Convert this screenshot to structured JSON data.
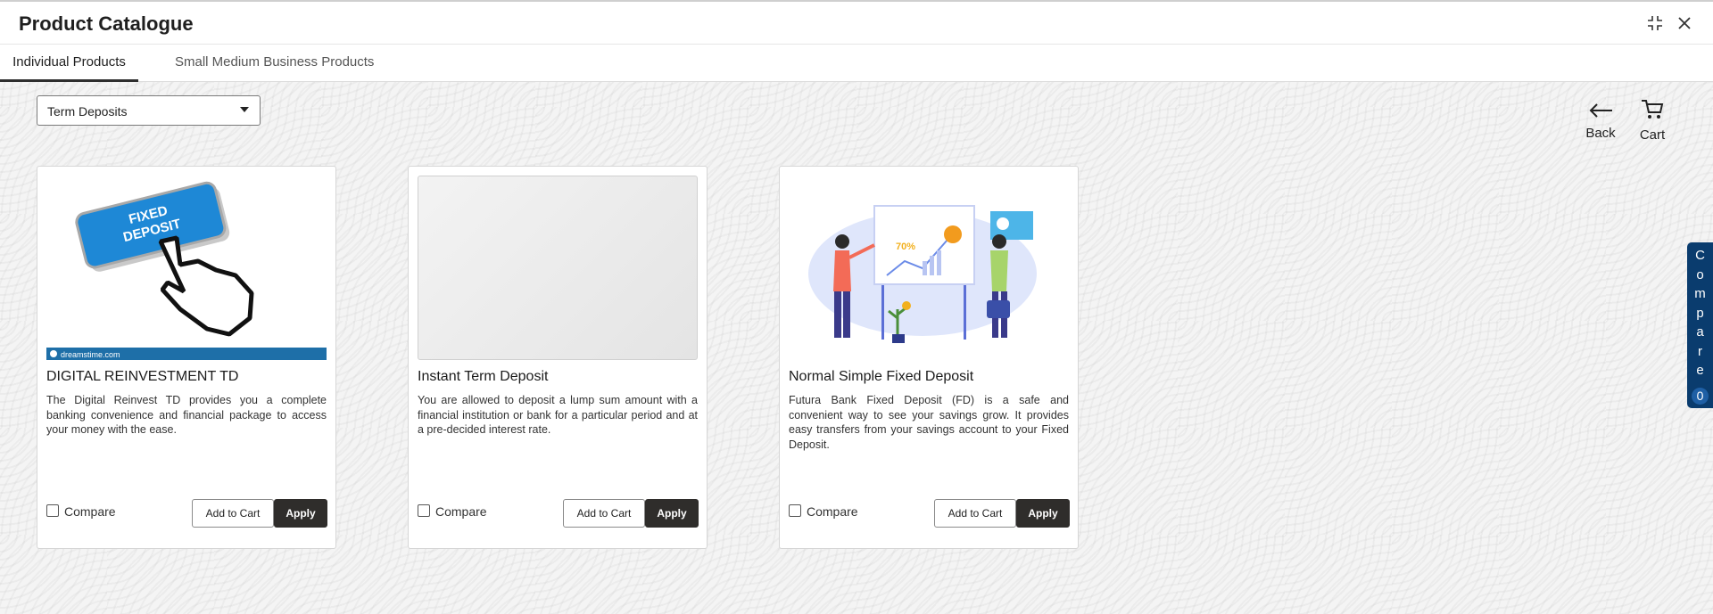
{
  "window": {
    "title": "Product Catalogue",
    "controls": [
      "minimize-icon",
      "close-icon"
    ]
  },
  "tabs": [
    {
      "label": "Individual Products",
      "active": true
    },
    {
      "label": "Small Medium Business Products",
      "active": false
    }
  ],
  "filter": {
    "selected": "Term Deposits"
  },
  "actions": {
    "back_label": "Back",
    "cart_label": "Cart"
  },
  "products": [
    {
      "title": "DIGITAL REINVESTMENT TD",
      "description": "The Digital Reinvest TD provides you a complete banking convenience and financial package to access your money with the ease.",
      "image": "fixed-deposit-button-image",
      "image_text": "FIXED DEPOSIT",
      "watermark": "dreamstime.com",
      "compare_label": "Compare",
      "add_to_cart_label": "Add to Cart",
      "apply_label": "Apply"
    },
    {
      "title": "Instant Term Deposit",
      "description": "You are allowed to deposit a lump sum amount with a financial institution or bank for a particular period and at a pre-decided interest rate.",
      "image": "blank-placeholder",
      "compare_label": "Compare",
      "add_to_cart_label": "Add to Cart",
      "apply_label": "Apply"
    },
    {
      "title": "Normal Simple Fixed Deposit",
      "description": "Futura Bank Fixed Deposit (FD) is a safe and convenient way to see your savings grow. It provides easy transfers from your savings account to your Fixed Deposit.",
      "image": "presentation-illustration",
      "image_text": "70%",
      "compare_label": "Compare",
      "add_to_cart_label": "Add to Cart",
      "apply_label": "Apply"
    }
  ],
  "compare_panel": {
    "label": "Compare",
    "count": "0"
  },
  "colors": {
    "primary_button": "#2f2d2b",
    "compare_panel": "#0a3c6e",
    "accent_blue": "#1e88d6"
  }
}
